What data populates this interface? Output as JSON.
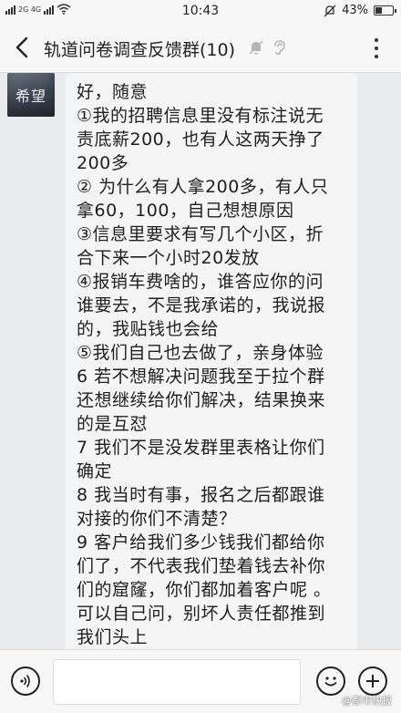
{
  "status_bar": {
    "network_label": "2G 4G",
    "time": "10:43",
    "battery_percent": "43%",
    "battery_level": 0.43
  },
  "header": {
    "title": "轨道问卷调查反馈群(10)",
    "icons": [
      "back-arrow-icon",
      "mute-bell-icon",
      "ear-icon",
      "more-vertical-icon"
    ]
  },
  "sender": {
    "avatar_text": "希望"
  },
  "message": {
    "lines": [
      "好，随意",
      "①我的招聘信息里没有标注说无",
      "责底薪200，也有人这两天挣了",
      "200多",
      "② 为什么有人拿200多，有人只",
      "拿60，100，自己想想原因",
      "③信息里要求有写几个小区，折",
      "合下来一个小时20发放",
      "④报销车费啥的，谁答应你的问",
      "谁要去，不是我承诺的，我说报",
      "的，我贴钱也会给",
      "⑤我们自己也去做了，亲身体验",
      "6 若不想解决问题我至于拉个群",
      "还想继续给你们解决，结果换来",
      "的是互怼",
      "7 我们不是没发群里表格让你们",
      "确定",
      "8 我当时有事，报名之后都跟谁",
      "对接的你们不清楚？",
      "9 客户给我们多少钱我们都给你",
      "们了，不代表我们垫着钱去补你",
      "们的窟窿，你们都加着客户呢 。",
      "可以自己问，别坏人责任都推到",
      "我们头上"
    ]
  },
  "input_bar": {
    "placeholder": "",
    "icons": [
      "voice-icon",
      "emoji-icon",
      "plus-icon"
    ]
  },
  "watermark": "@都市快报"
}
